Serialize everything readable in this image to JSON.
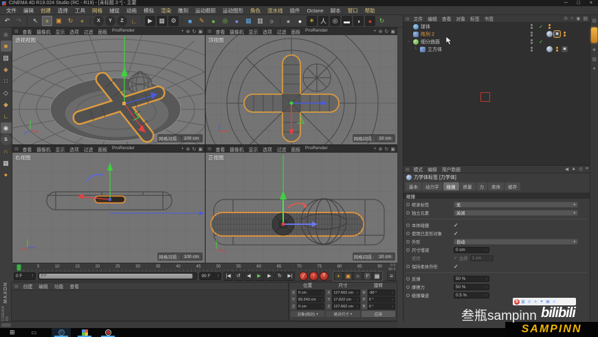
{
  "window": {
    "title": "CINEMA 4D R19.024 Studio (RC - R19) - [未标题 3 *] - 主要",
    "controls": [
      "─",
      "□",
      "×"
    ]
  },
  "menubar": [
    "文件",
    "编辑",
    "创建",
    "选择",
    "工具",
    "网格",
    "捕捉",
    "动画",
    "模拟",
    "渲染",
    "雕刻",
    "运动跟踪",
    "运动图形",
    "角色",
    "流水线",
    "插件",
    "Octane",
    "脚本",
    "窗口",
    "帮助"
  ],
  "toolbar": [
    {
      "name": "undo-icon",
      "glyph": "↶",
      "mod": "c-light"
    },
    {
      "name": "redo-icon",
      "glyph": "↷",
      "mod": "c-dim"
    },
    {
      "name": "separator",
      "mod": "sep"
    },
    {
      "name": "live-selection-icon",
      "glyph": "↖",
      "mod": "c-light"
    },
    {
      "name": "move-tool-icon",
      "glyph": "+",
      "mod": "c-yellow active"
    },
    {
      "name": "scale-tool-icon",
      "glyph": "▣",
      "mod": "c-orange"
    },
    {
      "name": "rotate-tool-icon",
      "glyph": "↻",
      "mod": "c-orange"
    },
    {
      "name": "last-tool-icon",
      "glyph": "+",
      "mod": "c-yellow"
    },
    {
      "name": "separator",
      "mod": "sep"
    },
    {
      "name": "lock-x-axis-icon",
      "glyph": "X",
      "mod": "c-axis"
    },
    {
      "name": "lock-y-axis-icon",
      "glyph": "Y",
      "mod": "c-axis"
    },
    {
      "name": "lock-z-axis-icon",
      "glyph": "Z",
      "mod": "c-axis"
    },
    {
      "name": "coordinate-system-icon",
      "glyph": "∟",
      "mod": "c-orange"
    },
    {
      "name": "separator",
      "mod": "sep"
    },
    {
      "name": "render-view-icon",
      "glyph": "▶",
      "mod": "c-clap"
    },
    {
      "name": "render-to-picture-viewer-icon",
      "glyph": "▦",
      "mod": "c-clap"
    },
    {
      "name": "render-settings-icon",
      "glyph": "⚙",
      "mod": "c-clap"
    },
    {
      "name": "separator",
      "mod": "sep"
    },
    {
      "name": "add-cube-icon",
      "glyph": "■",
      "mod": "c-blue"
    },
    {
      "name": "add-spline-icon",
      "glyph": "✎",
      "mod": "c-orange"
    },
    {
      "name": "add-subdivision-icon",
      "glyph": "●",
      "mod": "c-green"
    },
    {
      "name": "add-generator-icon",
      "glyph": "◎",
      "mod": "c-green"
    },
    {
      "name": "add-metaball-icon",
      "glyph": "●",
      "mod": "c-indigo"
    },
    {
      "name": "add-mograph-icon",
      "glyph": "▦",
      "mod": "c-blue"
    },
    {
      "name": "add-camera-icon",
      "glyph": "▥",
      "mod": "c-light"
    },
    {
      "name": "add-light-icon",
      "glyph": "○",
      "mod": "c-white"
    },
    {
      "name": "separator",
      "mod": "sep"
    },
    {
      "name": "material-sphere-icon",
      "glyph": "●",
      "mod": "c-gray2"
    },
    {
      "name": "material-sphere-light-icon",
      "glyph": "●",
      "mod": "c-white"
    },
    {
      "name": "sun-light-icon",
      "glyph": "☀",
      "mod": "c-yellow boxed"
    },
    {
      "name": "stage-icon",
      "glyph": "人",
      "mod": "c-light boxed"
    },
    {
      "name": "target-icon",
      "glyph": "◎",
      "mod": "c-light boxed"
    },
    {
      "name": "floor-icon",
      "glyph": "▬",
      "mod": "c-white boxed"
    },
    {
      "name": "environment-icon",
      "glyph": "◑",
      "mod": "c-light boxed"
    },
    {
      "name": "physical-sky-icon",
      "glyph": "●",
      "mod": "c-red boxed"
    },
    {
      "name": "refresh-icon",
      "glyph": "↻",
      "mod": "c-green"
    }
  ],
  "left_toolbar": [
    {
      "name": "make-editable-icon",
      "glyph": "◉",
      "mod": "c-dim"
    },
    {
      "name": "model-mode-icon",
      "glyph": "■",
      "mod": "c-orange active"
    },
    {
      "name": "texture-mode-icon",
      "glyph": "▨",
      "mod": "c-light"
    },
    {
      "name": "workplane-mode-icon",
      "glyph": "◆",
      "mod": "c-brown"
    },
    {
      "name": "points-mode-icon",
      "glyph": "∷",
      "mod": "c-light"
    },
    {
      "name": "edges-mode-icon",
      "glyph": "◇",
      "mod": "c-light"
    },
    {
      "name": "polygons-mode-icon",
      "glyph": "◆",
      "mod": "c-tan"
    },
    {
      "name": "axis-mode-icon",
      "glyph": "∟",
      "mod": "c-yellow"
    },
    {
      "name": "viewport-solo-icon",
      "glyph": "◉",
      "mod": "c-light active"
    },
    {
      "name": "enable-quantizing-icon",
      "glyph": "S",
      "mod": "c-light round"
    },
    {
      "name": "enable-snap-icon",
      "glyph": "∩",
      "mod": "c-orange"
    },
    {
      "name": "workplane-snap-icon",
      "glyph": "▦",
      "mod": "c-light"
    },
    {
      "name": "locked-workplane-icon",
      "glyph": "●",
      "mod": "c-orange"
    }
  ],
  "viewport_menu": [
    "查看",
    "摄像机",
    "显示",
    "选项",
    "过滤",
    "面板",
    "ProRender"
  ],
  "viewport_nav": [
    {
      "name": "pan-view-icon",
      "glyph": "+"
    },
    {
      "name": "zoom-view-icon",
      "glyph": "⊕"
    },
    {
      "name": "rotate-view-icon",
      "glyph": "↻"
    },
    {
      "name": "toggle-view-icon",
      "glyph": "▣"
    }
  ],
  "viewports": {
    "grid_key": "网格间隔 :",
    "perspective": {
      "label": "透视视图",
      "grid_value": "100 cm"
    },
    "top": {
      "label": "顶视图",
      "grid_value": "10 cm"
    },
    "right": {
      "label": "右视图",
      "grid_value": "100 cm"
    },
    "front": {
      "label": "正视图",
      "grid_value": "10 cm"
    }
  },
  "timeline": {
    "ticks": [
      "0",
      "5",
      "10",
      "15",
      "20",
      "25",
      "30",
      "35",
      "40",
      "45",
      "50",
      "55",
      "60",
      "65",
      "70",
      "75",
      "80",
      "85",
      "90"
    ],
    "range_start": "0 F",
    "range_end": "90 F"
  },
  "transport": {
    "current": "0 F",
    "slider_label": "0 F",
    "end": "90 F",
    "stepper": "↕",
    "buttons": [
      {
        "name": "goto-start-icon",
        "glyph": "|◀"
      },
      {
        "name": "play-loop-icon",
        "glyph": "↺"
      },
      {
        "name": "previous-frame-icon",
        "glyph": "◀"
      },
      {
        "name": "play-forward-icon",
        "glyph": "▶",
        "mod": "play"
      },
      {
        "name": "next-frame-icon",
        "glyph": "▶"
      },
      {
        "name": "play-mode-icon",
        "glyph": "↻"
      },
      {
        "name": "goto-end-icon",
        "glyph": "▶|"
      }
    ],
    "record_buttons": [
      {
        "name": "record-objects-icon",
        "glyph": "╱"
      },
      {
        "name": "autokeying-icon",
        "glyph": "↑"
      },
      {
        "name": "keyframe-selection-icon",
        "glyph": "?"
      }
    ],
    "toggles": [
      {
        "name": "record-position-toggle",
        "glyph": "+",
        "mod": "c-yellow"
      },
      {
        "name": "record-scale-toggle",
        "glyph": "▣",
        "mod": "c-orange"
      },
      {
        "name": "record-rotation-toggle",
        "glyph": "○",
        "mod": "c-light"
      },
      {
        "name": "record-parameter-toggle",
        "glyph": "Ⓟ",
        "mod": "c-light"
      },
      {
        "name": "record-pla-toggle",
        "glyph": "▦",
        "mod": "c-light"
      }
    ],
    "tracks_icon": "≡"
  },
  "object_manager": {
    "menu": [
      "文件",
      "编辑",
      "查看",
      "对象",
      "标签",
      "书签"
    ],
    "header_icons": [
      {
        "name": "search-icon",
        "glyph": "⊙"
      },
      {
        "name": "home-icon",
        "glyph": "⌂"
      },
      {
        "name": "filter-icon",
        "glyph": "◉"
      },
      {
        "name": "panel-menu-icon",
        "glyph": "▤"
      }
    ],
    "objects": [
      {
        "name": "球体"
      },
      {
        "name": "阵列 2"
      },
      {
        "name": "细分曲面"
      },
      {
        "name": "立方体"
      }
    ]
  },
  "attributes": {
    "menu": [
      "模式",
      "编辑",
      "用户数据"
    ],
    "header_icons": [
      {
        "name": "back-icon",
        "glyph": "◀"
      },
      {
        "name": "pin-icon",
        "glyph": "▲"
      },
      {
        "name": "search-icon",
        "glyph": "⊙"
      },
      {
        "name": "panel-menu-icon",
        "glyph": "≡"
      }
    ],
    "title": "力学体标签 [力学体]",
    "tabs": [
      {
        "label": "基本"
      },
      {
        "label": "动力学"
      },
      {
        "label": "碰撞",
        "mod": "active"
      },
      {
        "label": "质量"
      },
      {
        "label": "力"
      },
      {
        "label": "柔体"
      },
      {
        "label": "缓存"
      }
    ],
    "section": "碰撞",
    "fields": [
      {
        "label": "继承标签",
        "value": "无"
      },
      {
        "label": "独立元素",
        "value": "关闭"
      },
      {
        "label": "本体碰撞",
        "value": "✓"
      },
      {
        "label": "使用已变形对象",
        "value": "✓"
      },
      {
        "label": "外形",
        "value": "自动"
      },
      {
        "label": "尺寸增减",
        "value": "0 cm"
      },
      {
        "label": "使用",
        "value": "边界",
        "value2": "1 cm"
      },
      {
        "label": "保持柔体外形",
        "value": "✓"
      },
      {
        "label": "反弹",
        "value": "50 %"
      },
      {
        "label": "摩擦力",
        "value": "50 %"
      },
      {
        "label": "碰撞噪波",
        "value": "0.5 %"
      }
    ]
  },
  "coordinates": {
    "groups": [
      {
        "title": "位置",
        "footer": "对象(相对)",
        "rows": [
          {
            "axis": "X",
            "value": "0 cm"
          },
          {
            "axis": "Y",
            "value": "83.243 cm"
          },
          {
            "axis": "Z",
            "value": "0 cm"
          }
        ]
      },
      {
        "title": "尺寸",
        "footer": "绝对尺寸",
        "rows": [
          {
            "axis": "X",
            "value": "127.662 cm"
          },
          {
            "axis": "Y",
            "value": "17.622 cm"
          },
          {
            "axis": "Z",
            "value": "127.662 cm"
          }
        ]
      },
      {
        "title": "旋转",
        "footer": "应用",
        "rows": [
          {
            "axis": "H",
            "value": "-90 °"
          },
          {
            "axis": "P",
            "value": "0 °"
          },
          {
            "axis": "B",
            "value": "0 °"
          }
        ]
      }
    ]
  },
  "materials_menu": [
    "创建",
    "编辑",
    "功能",
    "查看"
  ],
  "branding": {
    "maxon": "MAXON",
    "cinema": "CINEMA 4D"
  },
  "sogou": {
    "logo": "S",
    "icons": [
      "英",
      "☺",
      "◑",
      "✦",
      "▤",
      "♪"
    ]
  },
  "watermark": {
    "author": "叁瓶sampinn",
    "platform": "bilibili",
    "badge": "SAMPINN"
  },
  "colors": {
    "accent_orange": "#e8a23c",
    "selection_outline": "#d99a3f",
    "play_green": "#5fd052",
    "record_red": "#d42a22",
    "bili_yellow": "#f0b400"
  }
}
